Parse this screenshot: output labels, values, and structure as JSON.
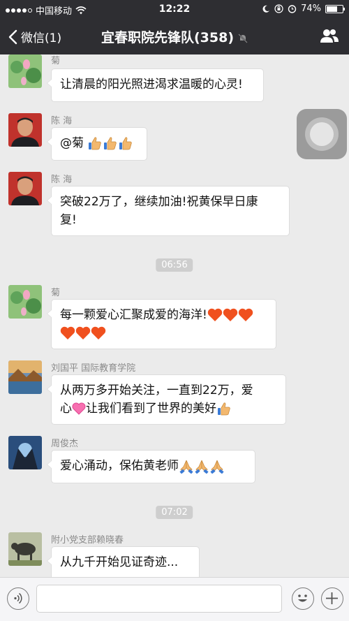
{
  "status_bar": {
    "carrier": "中国移动",
    "time": "12:22",
    "battery": "74%",
    "battery_level": 0.74
  },
  "nav": {
    "back_label": "微信(1)",
    "title": "宜春职院先锋队(358)"
  },
  "messages": [
    {
      "sender": "菊",
      "text": "让清晨的阳光照进渴求温暖的心灵!"
    },
    {
      "sender": "陈  海",
      "text": "@菊 ",
      "emoji": [
        "thumbs-up",
        "thumbs-up",
        "thumbs-up"
      ]
    },
    {
      "sender": "陈  海",
      "line1": "突破22万了，继续加油!祝黄保早日康",
      "line2": "复!"
    },
    {
      "time": "06:56"
    },
    {
      "sender": "菊",
      "text": "每一颗爱心汇聚成爱的海洋!",
      "emoji": [
        "heart",
        "heart",
        "heart",
        "heart",
        "heart",
        "heart"
      ]
    },
    {
      "sender": "刘国平 国际教育学院",
      "line1": "从两万多开始关注，一直到22万，爱",
      "line2a": "心",
      "line2b": "让我们看到了世界的美好"
    },
    {
      "sender": "周俊杰",
      "text": "爱心涌动，保佑黄老师"
    },
    {
      "time": "07:02"
    },
    {
      "sender": "附小党支部赖晓春",
      "text": "从九千开始见证奇迹..."
    }
  ],
  "colors": {
    "nav_bg": "#2e2e32",
    "chat_bg": "#ebebeb",
    "bubble_bg": "#ffffff",
    "heart": "#f0501e",
    "thumb": "#f3b86e"
  }
}
